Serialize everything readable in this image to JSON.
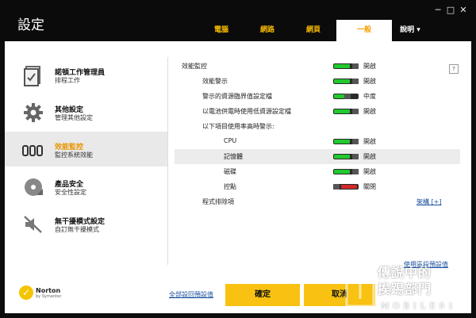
{
  "window": {
    "title": "設定"
  },
  "window_controls": [
    "─",
    "□",
    "✕"
  ],
  "tabs": [
    {
      "label": "電腦"
    },
    {
      "label": "網路"
    },
    {
      "label": "網頁"
    },
    {
      "label": "一般"
    },
    {
      "label": "說明 ▾"
    }
  ],
  "sidebar": {
    "items": [
      {
        "title": "諾頓工作管理員",
        "subtitle": "排程工作",
        "icon": "task-manager-icon"
      },
      {
        "title": "其他設定",
        "subtitle": "管理其他設定",
        "icon": "gear-icon"
      },
      {
        "title": "效能監控",
        "subtitle": "監控系統效能",
        "icon": "performance-icon"
      },
      {
        "title": "產品安全",
        "subtitle": "安全性設定",
        "icon": "disc-icon"
      },
      {
        "title": "無干擾模式設定",
        "subtitle": "自訂無干擾模式",
        "icon": "silent-mode-icon"
      }
    ]
  },
  "settings": {
    "help": "?",
    "rows": [
      {
        "label": "效能監控",
        "state": "開啟",
        "toggle": "on"
      },
      {
        "label": "效能警示",
        "state": "開啟",
        "toggle": "on"
      },
      {
        "label": "警示的資源臨界值設定檔",
        "state": "中度",
        "toggle": "mid"
      },
      {
        "label": "以電池供電時使用低資源設定檔",
        "state": "開啟",
        "toggle": "on"
      },
      {
        "label": "以下項目使用率高時警示:"
      },
      {
        "label": "CPU",
        "state": "開啟",
        "toggle": "on"
      },
      {
        "label": "記憶體",
        "state": "開啟",
        "toggle": "on"
      },
      {
        "label": "磁碟",
        "state": "開啟",
        "toggle": "on"
      },
      {
        "label": "控點",
        "state": "關閉",
        "toggle": "off"
      },
      {
        "label": "程式排除項",
        "link": "架構 [+]"
      }
    ]
  },
  "corner_link": "使用區段預設值",
  "footer": {
    "brand": "Norton",
    "brand_sub": "by Symantec",
    "reset_all": "全部設回預設值",
    "ok": "確定",
    "cancel": "取消"
  },
  "watermark": {
    "line1": "傳說中的",
    "line2": "挨踢部門",
    "line3": "MOBILE01"
  },
  "colors": {
    "accent": "#f9c212",
    "toggle_on": "#21c92e",
    "toggle_off": "#d02a2a",
    "tab_text": "#f5b800"
  }
}
